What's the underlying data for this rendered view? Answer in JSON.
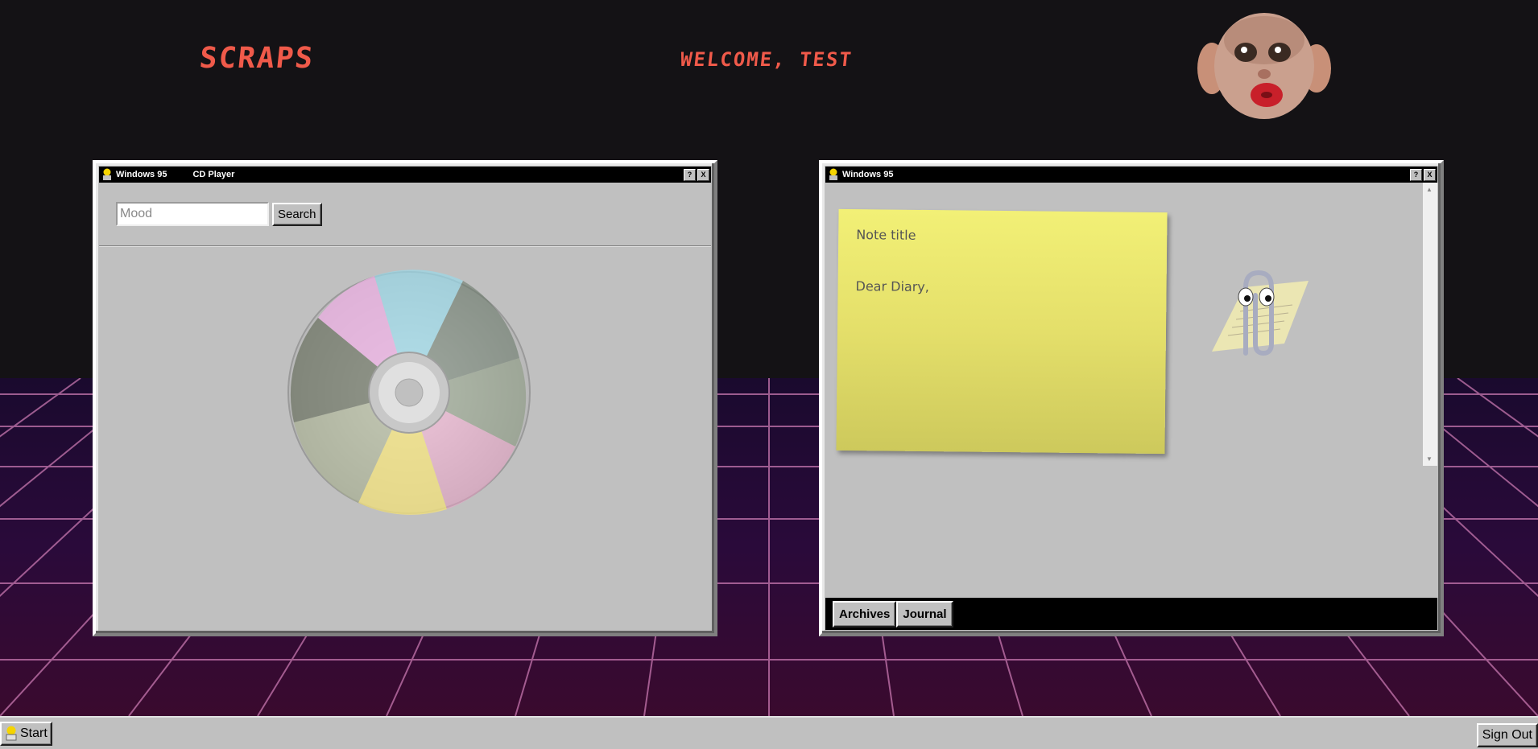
{
  "header": {
    "brand": "SCRAPS",
    "welcome": "WELCOME, TEST",
    "mascot_icon": "kissing-face-icon"
  },
  "cd_window": {
    "title": "Windows 95",
    "app_name": "CD Player",
    "help_label": "?",
    "close_label": "X",
    "search": {
      "placeholder": "Mood",
      "value": "",
      "button_label": "Search"
    },
    "disc_icon": "cd-disc-icon"
  },
  "note_window": {
    "title": "Windows 95",
    "help_label": "?",
    "close_label": "X",
    "note": {
      "title": "Note title",
      "body": "Dear Diary,"
    },
    "assistant_icon": "paperclip-assistant-icon",
    "tabs": [
      {
        "label": "Archives"
      },
      {
        "label": "Journal"
      }
    ]
  },
  "taskbar": {
    "start_label": "Start",
    "signout_label": "Sign Out"
  },
  "colors": {
    "accent": "#f05a4a",
    "background": "#141215",
    "window": "#c0c0c0",
    "grid_line": "#d47ab8"
  }
}
